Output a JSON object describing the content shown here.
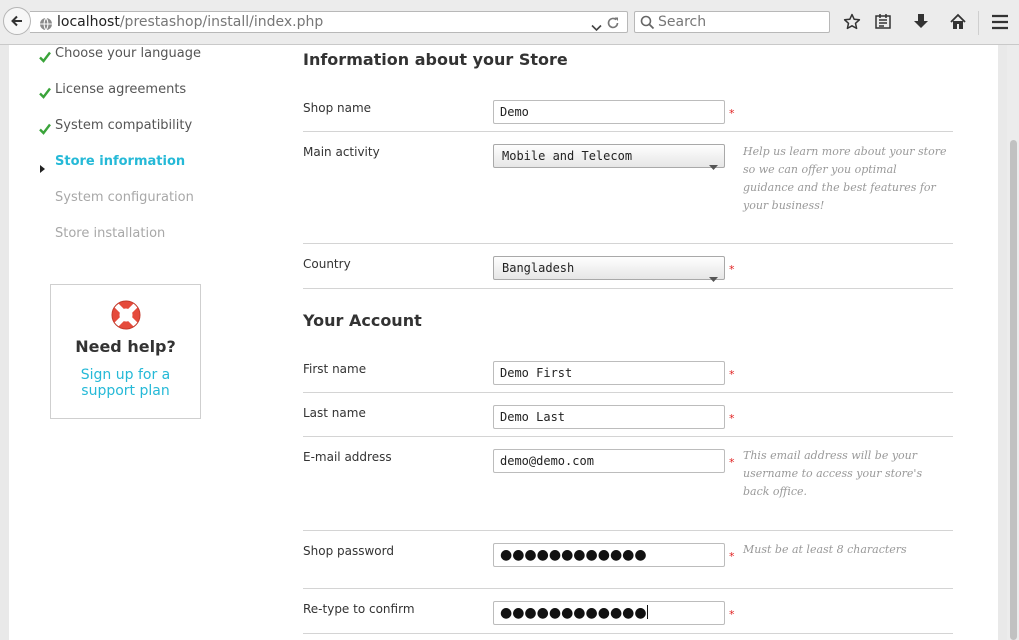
{
  "browser": {
    "url_host": "localhost",
    "url_path": "/prestashop/install/index.php",
    "search_placeholder": "Search"
  },
  "sidebar": {
    "steps": [
      {
        "label": "Choose your language",
        "state": "done"
      },
      {
        "label": "License agreements",
        "state": "done"
      },
      {
        "label": "System compatibility",
        "state": "done"
      },
      {
        "label": "Store information",
        "state": "active"
      },
      {
        "label": "System configuration",
        "state": "pending"
      },
      {
        "label": "Store installation",
        "state": "pending"
      }
    ],
    "help": {
      "title": "Need help?",
      "link_line1": "Sign up for a",
      "link_line2": "support plan"
    }
  },
  "store_section": {
    "title": "Information about your Store",
    "shop_name": {
      "label": "Shop name",
      "value": "Demo"
    },
    "main_activity": {
      "label": "Main activity",
      "value": "Mobile and Telecom",
      "hint_lines": [
        "Help us learn more about your store",
        "so we can offer you optimal",
        "guidance and the best features for",
        "your business!"
      ]
    },
    "country": {
      "label": "Country",
      "value": "Bangladesh"
    }
  },
  "account_section": {
    "title": "Your Account",
    "first_name": {
      "label": "First name",
      "value": "Demo First"
    },
    "last_name": {
      "label": "Last name",
      "value": "Demo Last"
    },
    "email": {
      "label": "E-mail address",
      "value": "demo@demo.com",
      "hint_lines": [
        "This email address will be your",
        "username to access your store's",
        "back office."
      ]
    },
    "password": {
      "label": "Shop password",
      "masked": "●●●●●●●●●●●●",
      "hint": "Must be at least 8 characters"
    },
    "confirm": {
      "label": "Re-type to confirm",
      "masked": "●●●●●●●●●●●●"
    }
  },
  "required_mark": "*",
  "colors": {
    "accent": "#25b9d7",
    "check": "#3aa43a",
    "required": "#e02020"
  }
}
